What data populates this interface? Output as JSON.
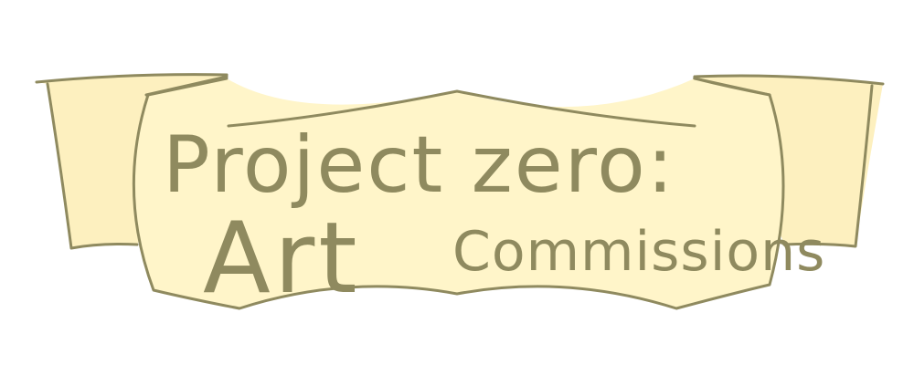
{
  "banner": {
    "line1": "Project zero:",
    "line2_art": "Art",
    "line2_commissions": "Commissions"
  },
  "colors": {
    "ribbon_fill": "#fff5c9",
    "ribbon_outline": "#8f8a5f",
    "text": "#8f8a5f",
    "background": "#ffffff"
  }
}
